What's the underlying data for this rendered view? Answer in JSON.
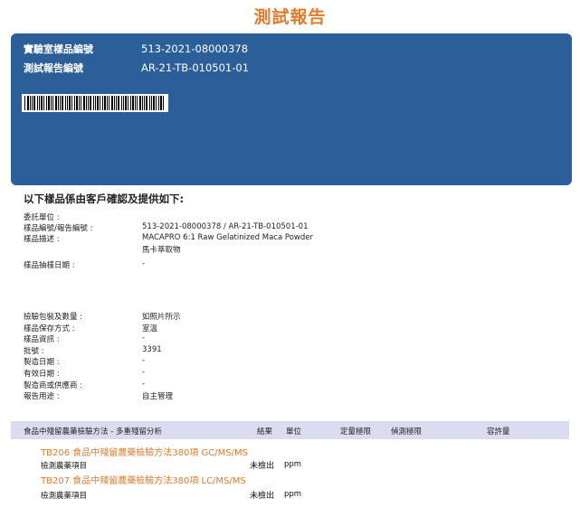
{
  "report_title": "測試報告",
  "hero": {
    "lab_sample_no_label": "實驗室樣品編號",
    "lab_sample_no": "513-2021-08000378",
    "report_no_label": "測試報告編號",
    "report_no": "AR-21-TB-010501-01"
  },
  "intro": "以下樣品係由客戶確認及提供如下:",
  "info_top": [
    {
      "label": "委託單位 :",
      "value": ""
    },
    {
      "label": "樣品編號/報告編號 :",
      "value": "513-2021-08000378   /   AR-21-TB-010501-01"
    },
    {
      "label": "樣品描述 :",
      "value": "MACAPRO 6:1 Raw Gelatinized Maca Powder"
    },
    {
      "label": "",
      "value": "馬卡萃取物"
    },
    {
      "label": "樣品抽樣日期 :",
      "value": "-"
    }
  ],
  "info_bottom": [
    {
      "label": "檢驗包裝及數量 :",
      "value": "如照片所示"
    },
    {
      "label": "樣品保存方式 :",
      "value": "室溫"
    },
    {
      "label": "樣品資訊 :",
      "value": "-"
    },
    {
      "label": "批號 :",
      "value": "3391"
    },
    {
      "label": "製造日期 :",
      "value": "-"
    },
    {
      "label": "有效日期 :",
      "value": "-"
    },
    {
      "label": "製造商或供應商 :",
      "value": "-"
    },
    {
      "label": "報告用途 :",
      "value": "自主管理"
    }
  ],
  "table_header": {
    "method": "食品中殘留農藥檢驗方法 - 多重殘留分析",
    "result": "結果",
    "unit": "單位",
    "loq": "定量極限",
    "lod": "偵測極限",
    "tolerance": "容許量"
  },
  "tests": [
    {
      "code_method": "TB206  食品中殘留農藥檢驗方法380項 GC/MS/MS",
      "item": "檢測農藥項目",
      "result": "未檢出",
      "unit": "ppm"
    },
    {
      "code_method": "TB207  食品中殘留農藥檢驗方法380項 LC/MS/MS",
      "item": "檢測農藥項目",
      "result": "未檢出",
      "unit": "ppm"
    }
  ]
}
